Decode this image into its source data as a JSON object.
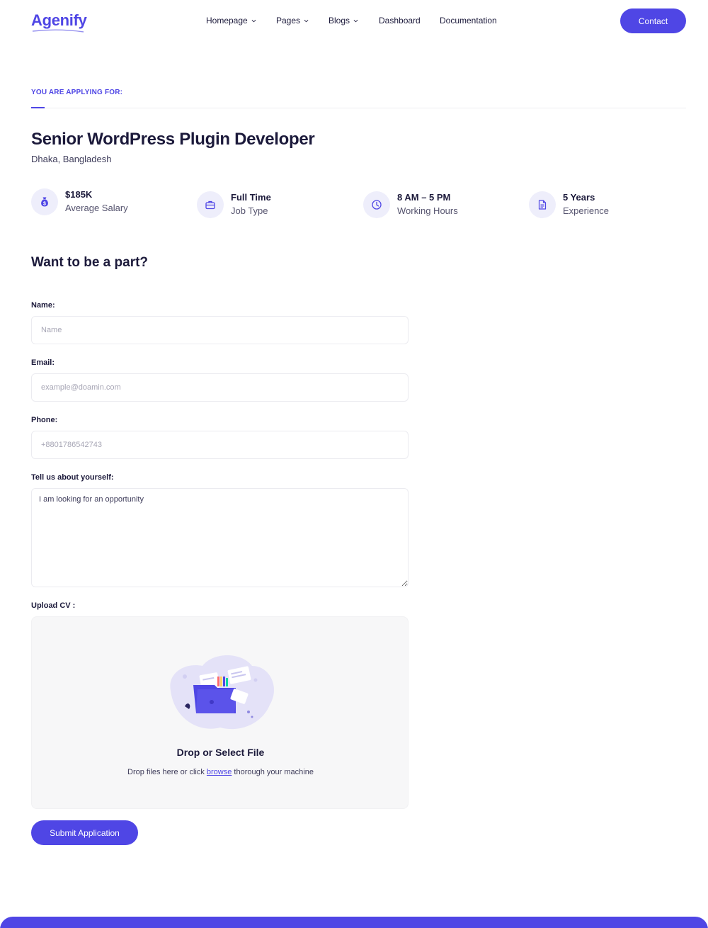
{
  "brand": {
    "name": "Agenify",
    "accent": "#4f46e5"
  },
  "nav": {
    "items": [
      {
        "label": "Homepage",
        "has_dropdown": true
      },
      {
        "label": "Pages",
        "has_dropdown": true
      },
      {
        "label": "Blogs",
        "has_dropdown": true
      },
      {
        "label": "Dashboard",
        "has_dropdown": false
      },
      {
        "label": "Documentation",
        "has_dropdown": false
      }
    ],
    "contact_label": "Contact"
  },
  "job": {
    "applying_label": "YOU ARE APPLYING FOR:",
    "title": "Senior WordPress Plugin Developer",
    "location": "Dhaka, Bangladesh",
    "stats": [
      {
        "icon": "money-bag-icon",
        "value": "$185K",
        "label": "Average Salary"
      },
      {
        "icon": "briefcase-icon",
        "value": "Full Time",
        "label": "Job Type"
      },
      {
        "icon": "clock-icon",
        "value": "8 AM – 5 PM",
        "label": "Working Hours"
      },
      {
        "icon": "document-icon",
        "value": "5 Years",
        "label": "Experience"
      }
    ]
  },
  "form": {
    "section_title": "Want to be a part?",
    "name": {
      "label": "Name:",
      "placeholder": "Name"
    },
    "email": {
      "label": "Email:",
      "placeholder": "example@doamin.com"
    },
    "phone": {
      "label": "Phone:",
      "placeholder": "+8801786542743"
    },
    "about": {
      "label": "Tell us about yourself:",
      "value": "I am looking for an opportunity"
    },
    "upload": {
      "label": "Upload CV :",
      "title": "Drop or Select File",
      "desc_before": "Drop files here or click ",
      "desc_link": "browse",
      "desc_after": " thorough your machine"
    },
    "submit_label": "Submit Application"
  }
}
